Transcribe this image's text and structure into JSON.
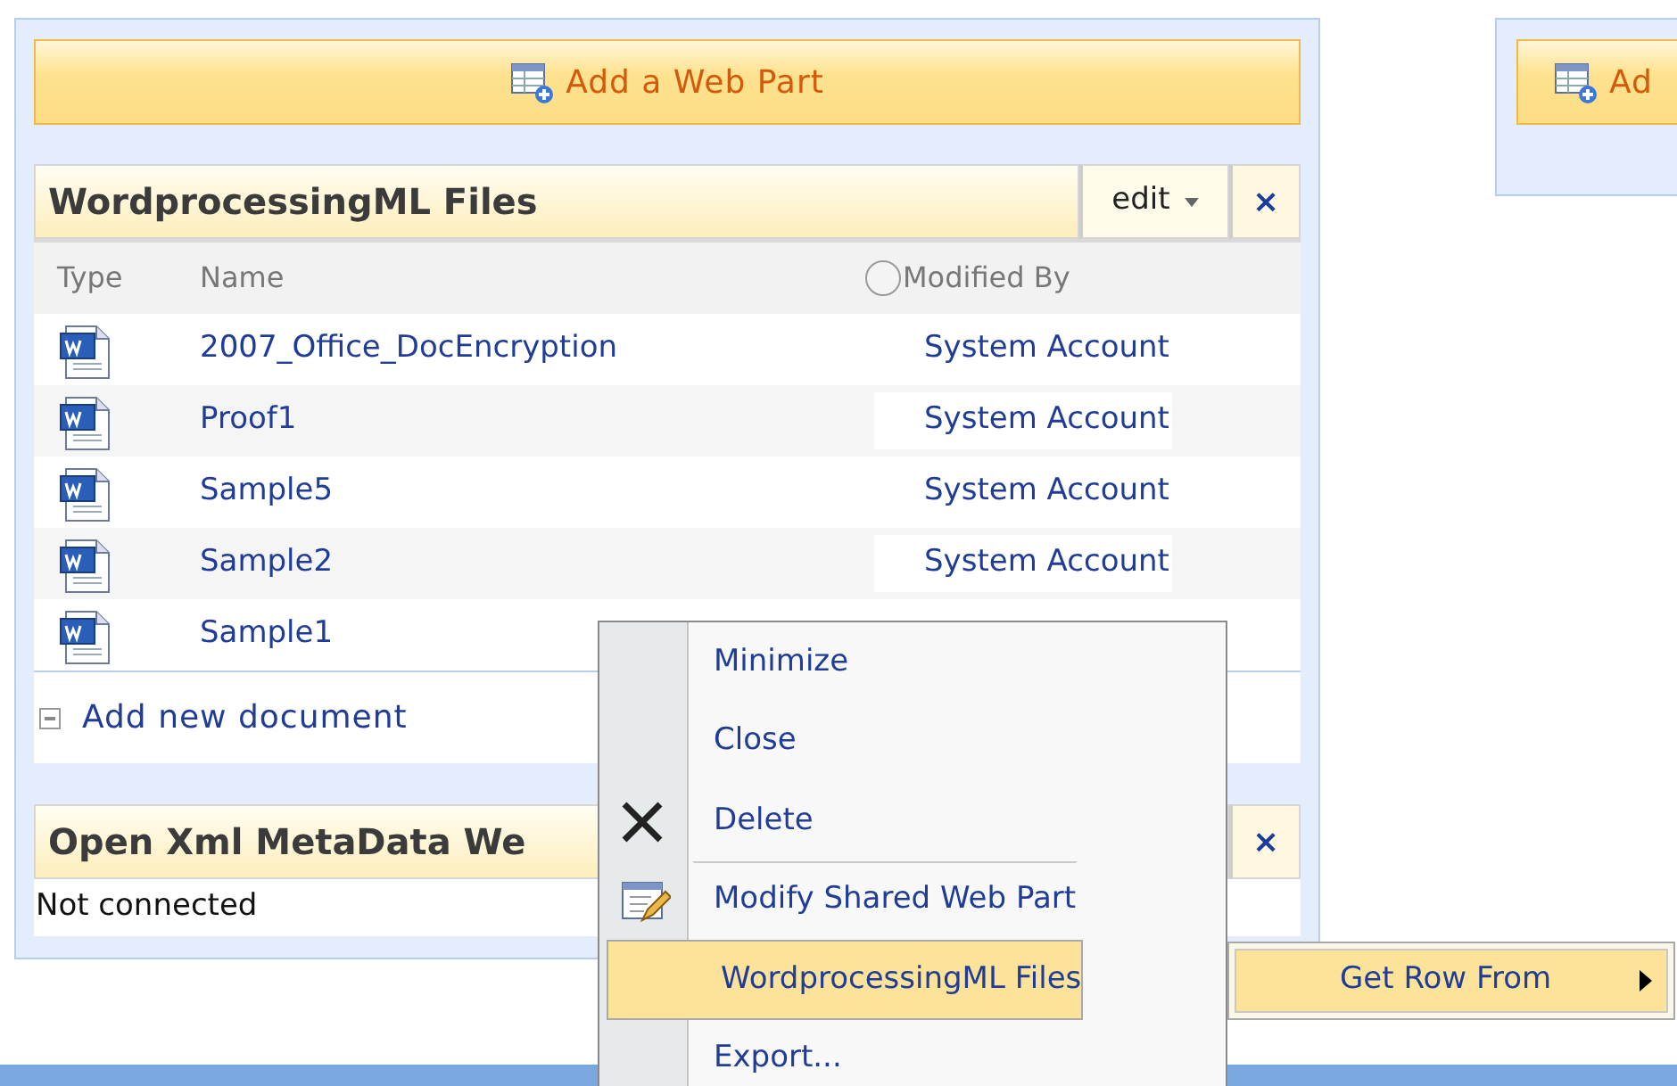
{
  "zones": [
    {
      "add_button": "Add a Web Part",
      "web_parts": [
        {
          "kind": "list",
          "title": "WordprocessingML Files",
          "edit_menu": "edit",
          "close": "×",
          "columns": [
            "Type",
            "Name",
            "Modified By"
          ],
          "rows": [
            {
              "name": "2007_Office_DocEncryption",
              "modified_by": "System Account"
            },
            {
              "name": "Proof1",
              "modified_by": "System Account"
            },
            {
              "name": "Sample5",
              "modified_by": "System Account"
            },
            {
              "name": "Sample2",
              "modified_by": "System Account"
            },
            {
              "name": "Sample1"
            }
          ],
          "add_link": "Add new document"
        },
        {
          "kind": "text",
          "title": "Open Xml MetaData We",
          "close": "×",
          "body": "Not connected"
        }
      ]
    },
    {
      "add_button": "Ad"
    }
  ],
  "context_menu": {
    "items": [
      {
        "label": "Minimize",
        "kind": "plain",
        "divider_above": false,
        "selected": false
      },
      {
        "label": "Close",
        "kind": "plain",
        "divider_above": false,
        "selected": false
      },
      {
        "label": "Delete",
        "kind": "delete",
        "divider_above": false,
        "selected": false
      },
      {
        "label": "Modify Shared Web Part",
        "kind": "edit",
        "divider_above": true,
        "selected": false
      },
      {
        "label": "WordprocessingML Files",
        "kind": "plain",
        "divider_above": false,
        "selected": true
      },
      {
        "label": "Export...",
        "kind": "plain",
        "divider_above": false,
        "selected": false
      }
    ],
    "submenu": {
      "label": "Get Row From",
      "selected": true
    }
  }
}
